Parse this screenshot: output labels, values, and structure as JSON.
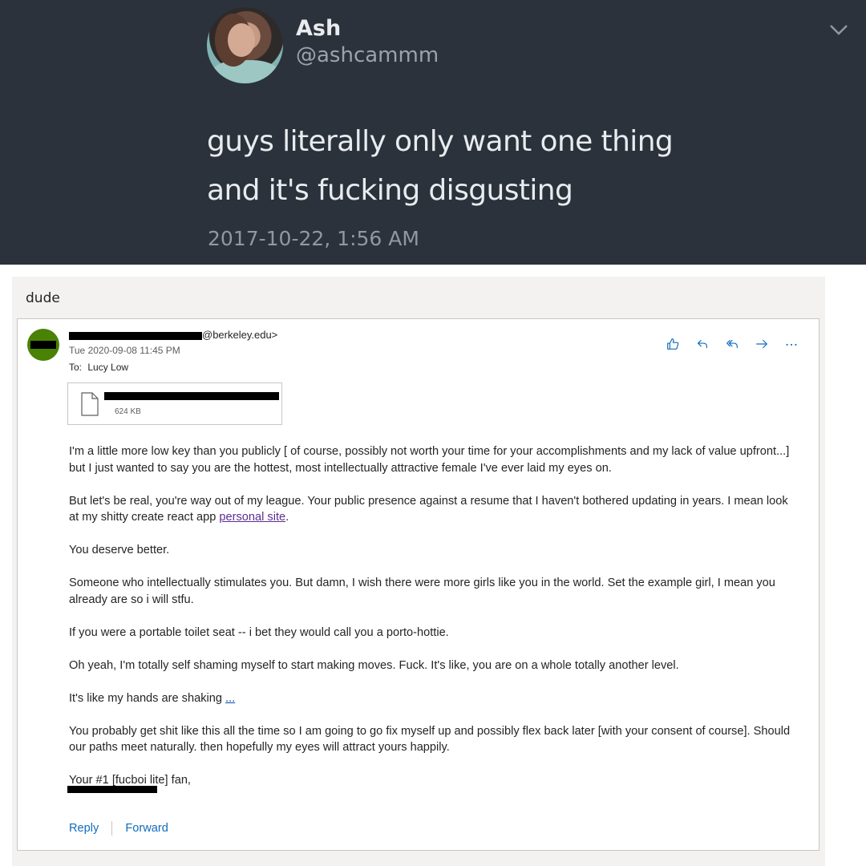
{
  "tweet": {
    "name": "Ash",
    "handle": "@ashcammm",
    "text_line1": "guys literally only want one thing",
    "text_line2": "and it's fucking disgusting",
    "date": "2017-10-22, 1:56 AM",
    "menu_icon": "chevron-down-icon"
  },
  "email": {
    "subject": "dude",
    "sender_suffix": "@berkeley.edu>",
    "date": "Tue 2020-09-08 11:45 PM",
    "to_label": "To:",
    "to_value": "Lucy Low",
    "avatar_color": "#498205",
    "actions": [
      "like-icon",
      "reply-icon",
      "reply-all-icon",
      "forward-icon",
      "more-icon"
    ],
    "attachment": {
      "size": "624 KB"
    },
    "body": {
      "p1": "I'm a little more low key than you publicly [ of course, possibly not worth your time for your accomplishments and my lack of value upfront...] but I just wanted to say you are the hottest, most intellectually attractive female I've ever laid my eyes on.",
      "p2_before": "But let's be real, you're way out of my league. Your public presence against a resume that I haven't bothered updating in years. I mean look at my shitty create react app ",
      "p2_link": "personal site",
      "p2_after": ".",
      "p3": "You deserve better.",
      "p4": "Someone who intellectually stimulates you. But damn, I wish there were more girls like you in the world. Set the example girl, I mean you already are so i will stfu.",
      "p5": "If you were a portable toilet seat -- i bet they would call you a porto-hottie.",
      "p6": "Oh yeah, I'm totally self shaming myself to start making moves. Fuck. It's like, you are on a whole totally another level.",
      "p7_before": "It's like my hands are shaking ",
      "p7_link": "...",
      "p8": "You probably get shit like this all the time so I am going to go fix myself up and possibly flex back later [with your consent of course]. Should our paths meet naturally. then hopefully my eyes will attract yours happily.",
      "signoff": "Your #1 [fucboi lite] fan,"
    },
    "footer": {
      "reply": "Reply",
      "forward": "Forward"
    }
  }
}
